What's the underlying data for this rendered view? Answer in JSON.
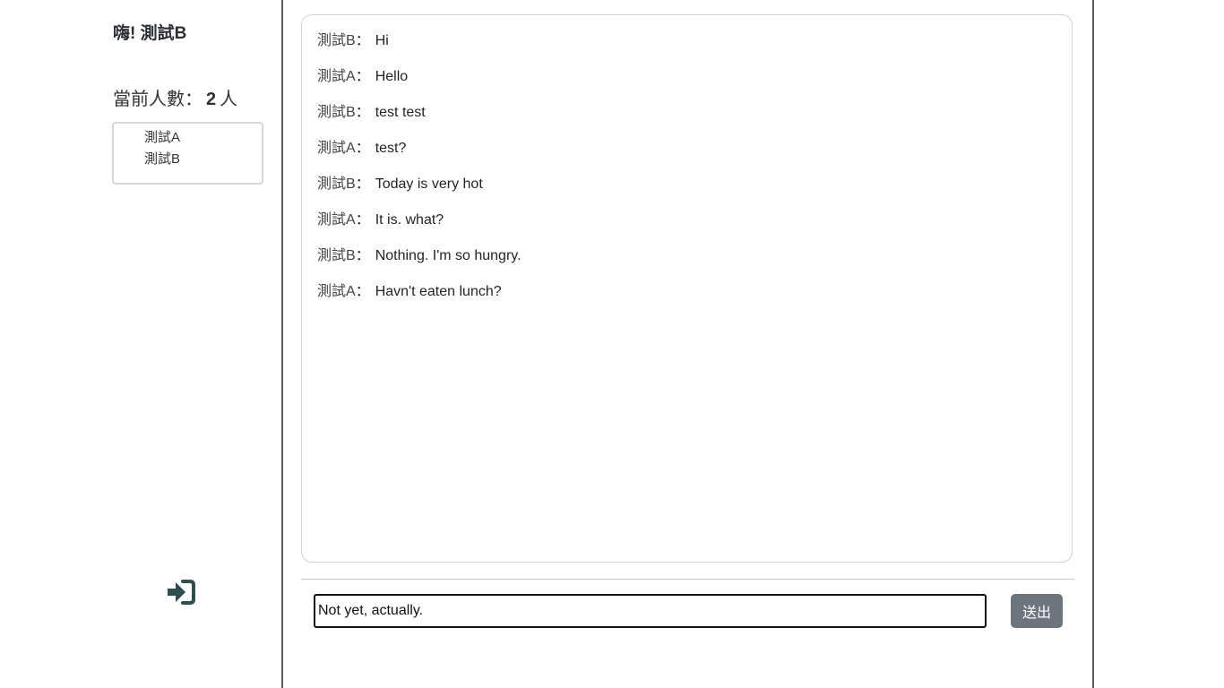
{
  "sidebar": {
    "greeting": "嗨! 測試B",
    "online_label": "當前人數：",
    "online_count": "2",
    "online_unit": "人",
    "users": [
      "測試A",
      "測試B"
    ],
    "logout_icon": "sign-in-alt-icon"
  },
  "chat": {
    "separator": "：",
    "messages": [
      {
        "sender": "測試B",
        "text": "Hi"
      },
      {
        "sender": "測試A",
        "text": "Hello"
      },
      {
        "sender": "測試B",
        "text": "test test"
      },
      {
        "sender": "測試A",
        "text": "test?"
      },
      {
        "sender": "測試B",
        "text": "Today is very hot"
      },
      {
        "sender": "測試A",
        "text": "It is. what?"
      },
      {
        "sender": "測試B",
        "text": "Nothing. I'm so hungry."
      },
      {
        "sender": "測試A",
        "text": "Havn't eaten lunch?"
      }
    ]
  },
  "composer": {
    "value": "Not yet, actually.",
    "send_label": "送出"
  },
  "colors": {
    "send_button": "#6c757d",
    "icon": "#2f4f4f"
  }
}
